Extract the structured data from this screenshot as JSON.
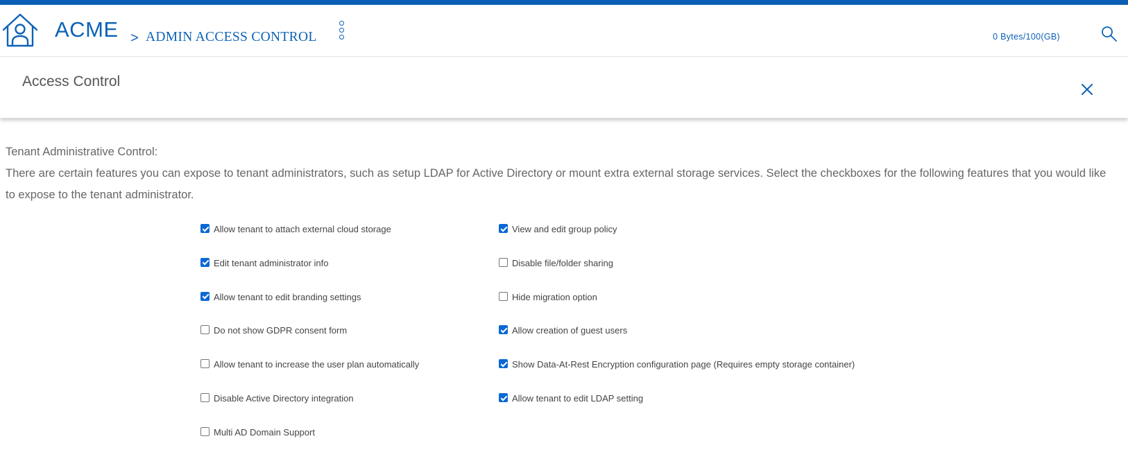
{
  "header": {
    "brand": "ACME",
    "breadcrumb_sep": ">",
    "breadcrumb": "ADMIN ACCESS CONTROL",
    "storage": "0 Bytes/100(GB)",
    "icons": [
      "home-icon",
      "kebab-menu-icon",
      "search-icon"
    ],
    "accent_color": "#0b62b5"
  },
  "panel": {
    "title": "Access Control",
    "close_icon": "close-icon"
  },
  "description": {
    "heading": "Tenant Administrative Control:",
    "body": "There are certain features you can expose to tenant administrators, such as setup LDAP for Active Directory or mount extra external storage services. Select the checkboxes for the following features that you would like to expose to the tenant administrator."
  },
  "options_left": [
    {
      "label": "Allow tenant to attach external cloud storage",
      "checked": true
    },
    {
      "label": "Edit tenant administrator info",
      "checked": true
    },
    {
      "label": "Allow tenant to edit branding settings",
      "checked": true
    },
    {
      "label": "Do not show GDPR consent form",
      "checked": false
    },
    {
      "label": "Allow tenant to increase the user plan automatically",
      "checked": false
    },
    {
      "label": "Disable Active Directory integration",
      "checked": false
    },
    {
      "label": "Multi AD Domain Support",
      "checked": false
    }
  ],
  "options_right": [
    {
      "label": "View and edit group policy",
      "checked": true
    },
    {
      "label": "Disable file/folder sharing",
      "checked": false
    },
    {
      "label": "Hide migration option",
      "checked": false
    },
    {
      "label": "Allow creation of guest users",
      "checked": true
    },
    {
      "label": "Show Data-At-Rest Encryption configuration page (Requires empty storage container)",
      "checked": true
    },
    {
      "label": "Allow tenant to edit LDAP setting",
      "checked": true
    }
  ]
}
